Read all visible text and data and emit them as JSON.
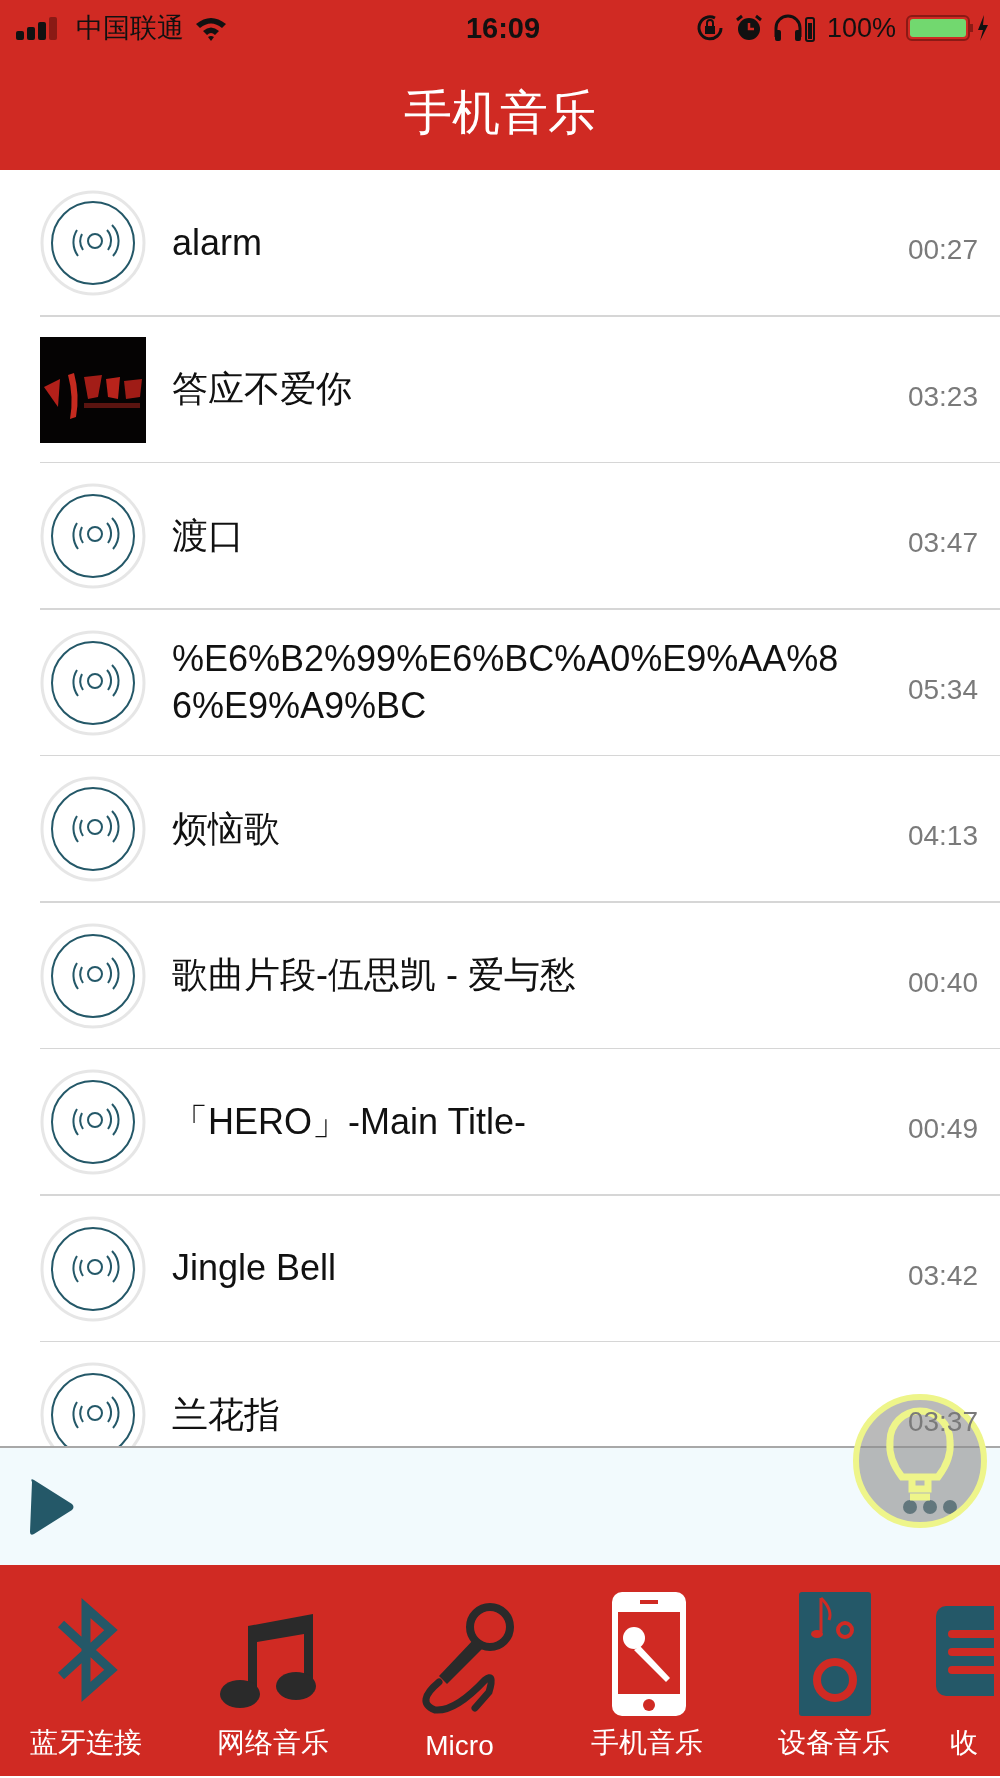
{
  "status_bar": {
    "carrier": "中国联通",
    "time": "16:09",
    "battery_percent": "100%"
  },
  "header": {
    "title": "手机音乐"
  },
  "songs": [
    {
      "title": "alarm",
      "duration": "00:27",
      "kind": "disc"
    },
    {
      "title": "答应不爱你",
      "duration": "03:23",
      "kind": "picture"
    },
    {
      "title": "渡口",
      "duration": "03:47",
      "kind": "disc"
    },
    {
      "title": "%E6%B2%99%E6%BC%A0%E9%AA%86%E9%A9%BC",
      "duration": "05:34",
      "kind": "disc"
    },
    {
      "title": "烦恼歌",
      "duration": "04:13",
      "kind": "disc"
    },
    {
      "title": "歌曲片段-伍思凯 - 爱与愁",
      "duration": "00:40",
      "kind": "disc"
    },
    {
      "title": "「HERO」-Main Title-",
      "duration": "00:49",
      "kind": "disc"
    },
    {
      "title": "Jingle Bell",
      "duration": "03:42",
      "kind": "disc"
    },
    {
      "title": "兰花指",
      "duration": "03:37",
      "kind": "disc"
    }
  ],
  "tabs": [
    {
      "label": "蓝牙连接",
      "kind": "bluetooth",
      "selected": false
    },
    {
      "label": "网络音乐",
      "kind": "music",
      "selected": false
    },
    {
      "label": "Micro",
      "kind": "microphone",
      "selected": false
    },
    {
      "label": "手机音乐",
      "kind": "phone",
      "selected": true
    },
    {
      "label": "设备音乐",
      "kind": "speaker",
      "selected": false
    },
    {
      "label": "收",
      "kind": "list",
      "selected": false
    }
  ]
}
